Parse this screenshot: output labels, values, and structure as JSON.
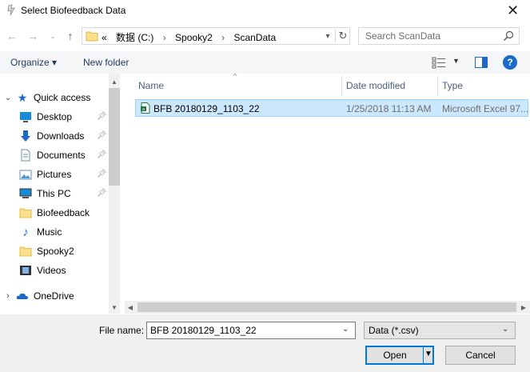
{
  "window": {
    "title": "Select Biofeedback Data"
  },
  "nav": {
    "breadcrumb_prefix": "«",
    "breadcrumb": [
      "数据 (C:)",
      "Spooky2",
      "ScanData"
    ],
    "search_placeholder": "Search ScanData"
  },
  "toolbar": {
    "organize": "Organize ▾",
    "new_folder": "New folder"
  },
  "sidebar": {
    "quick_access": "Quick access",
    "items": [
      {
        "label": "Desktop",
        "icon": "desktop-icon",
        "pinned": true
      },
      {
        "label": "Downloads",
        "icon": "download-icon",
        "pinned": true
      },
      {
        "label": "Documents",
        "icon": "documents-icon",
        "pinned": true
      },
      {
        "label": "Pictures",
        "icon": "pictures-icon",
        "pinned": true
      },
      {
        "label": "This PC",
        "icon": "pc-icon",
        "pinned": true
      },
      {
        "label": "Biofeedback",
        "icon": "folder-icon",
        "pinned": false
      },
      {
        "label": "Music",
        "icon": "music-icon",
        "pinned": false
      },
      {
        "label": "Spooky2",
        "icon": "folder-icon",
        "pinned": false
      },
      {
        "label": "Videos",
        "icon": "videos-icon",
        "pinned": false
      }
    ],
    "onedrive": "OneDrive"
  },
  "columns": {
    "name": "Name",
    "date": "Date modified",
    "type": "Type"
  },
  "files": [
    {
      "name": "BFB 20180129_1103_22",
      "date": "1/25/2018 11:13 AM",
      "type": "Microsoft Excel 97..."
    }
  ],
  "bottom": {
    "filename_label": "File name:",
    "filename_value": "BFB 20180129_1103_22",
    "filter_value": "Data (*.csv)",
    "open_label": "Open",
    "cancel_label": "Cancel"
  },
  "colors": {
    "selection": "#cce8ff",
    "accent": "#0078d7",
    "help": "#1b6ac9"
  }
}
